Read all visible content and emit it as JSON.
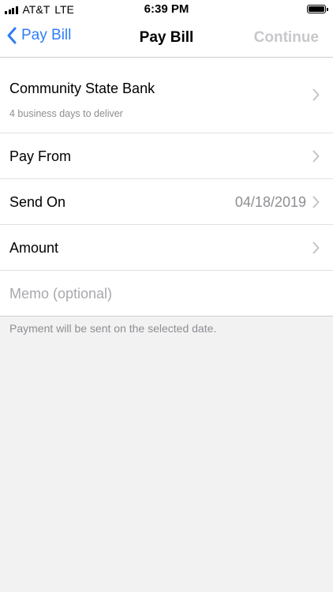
{
  "status_bar": {
    "carrier": "AT&T",
    "network": "LTE",
    "time": "6:39 PM"
  },
  "nav": {
    "back_label": "Pay Bill",
    "title": "Pay Bill",
    "continue_label": "Continue"
  },
  "rows": {
    "payee": {
      "label": "Community State Bank",
      "sublabel": "4 business days to deliver"
    },
    "pay_from": {
      "label": "Pay From"
    },
    "send_on": {
      "label": "Send On",
      "value": "04/18/2019"
    },
    "amount": {
      "label": "Amount"
    },
    "memo": {
      "placeholder": "Memo (optional)"
    }
  },
  "footer_note": "Payment will be sent on the selected date.",
  "colors": {
    "accent": "#2f7cf6",
    "disabled": "#c8c8cc",
    "secondary_text": "#8e8e93",
    "background": "#f2f2f3"
  }
}
